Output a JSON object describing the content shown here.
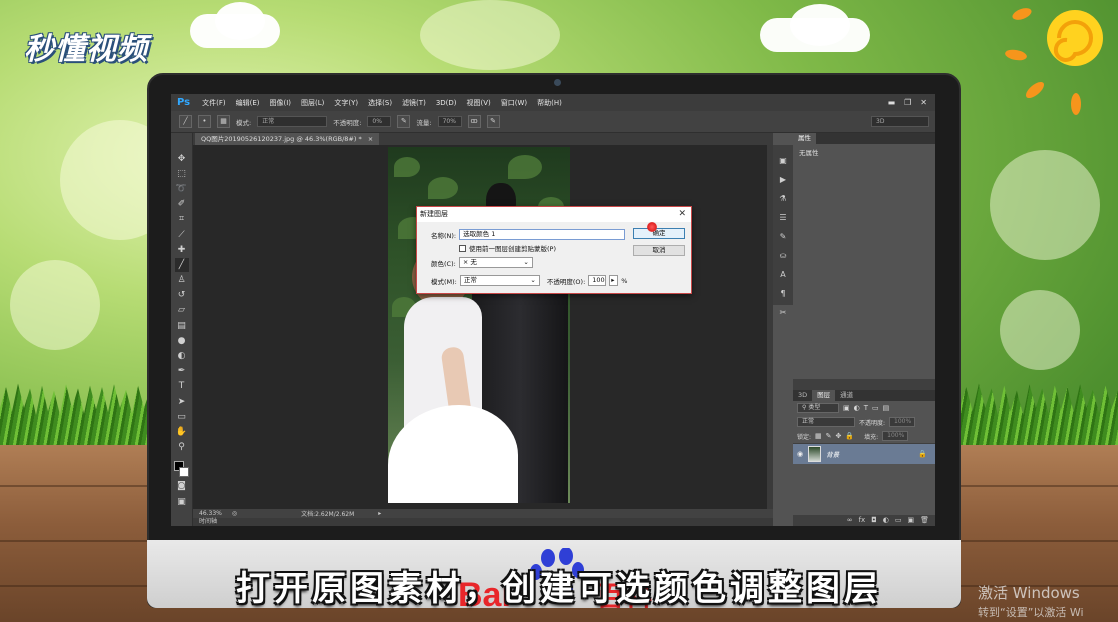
{
  "branding": {
    "logo_text": "秒懂视频",
    "baidu_mark_text": "Bai",
    "baidu_mark_text2": "百科"
  },
  "subtitle": "打开原图素材，创建可选颜色调整图层",
  "windows_watermark": {
    "line1": "激活 Windows",
    "line2": "转到“设置”以激活 Wi"
  },
  "photoshop": {
    "app_logo": "Ps",
    "menu": [
      "文件(F)",
      "编辑(E)",
      "图像(I)",
      "图层(L)",
      "文字(Y)",
      "选择(S)",
      "滤镜(T)",
      "3D(D)",
      "视图(V)",
      "窗口(W)",
      "帮助(H)"
    ],
    "window_controls": [
      "▬",
      "❐",
      "✕"
    ],
    "options_bar": {
      "mode_label": "模式:",
      "mode_value": "正常",
      "opacity_label": "不透明度:",
      "opacity_value": "0%",
      "flow_label": "流量:",
      "flow_value": "70%",
      "workspace_value": "3D"
    },
    "document_tab": "QQ图片20190526120237.jpg @ 46.3%(RGB/8#) *",
    "status": {
      "zoom": "46.33%",
      "doc_info": "文档:2.62M/2.62M"
    },
    "timeline_label": "时间轴",
    "properties_panel": {
      "tab": "属性",
      "body": "无属性"
    },
    "layers_panel": {
      "tabs": [
        "3D",
        "图层",
        "通道"
      ],
      "filter_kind": "类型",
      "blend_mode": "正常",
      "opacity_label": "不透明度:",
      "opacity_value": "100%",
      "lock_label": "锁定:",
      "fill_label": "填充:",
      "fill_value": "100%",
      "layer_name": "背景"
    },
    "new_layer_dialog": {
      "title": "新建图层",
      "name_label": "名称(N):",
      "name_value": "选取颜色 1",
      "clip_checkbox_label": "使用前一图层创建剪贴蒙版(P)",
      "color_label": "颜色(C):",
      "color_value": "× 无",
      "mode_label": "模式(M):",
      "mode_value": "正常",
      "opacity_label": "不透明度(O):",
      "opacity_value": "100",
      "opacity_unit": "%",
      "ok_label": "确定",
      "cancel_label": "取消"
    }
  }
}
